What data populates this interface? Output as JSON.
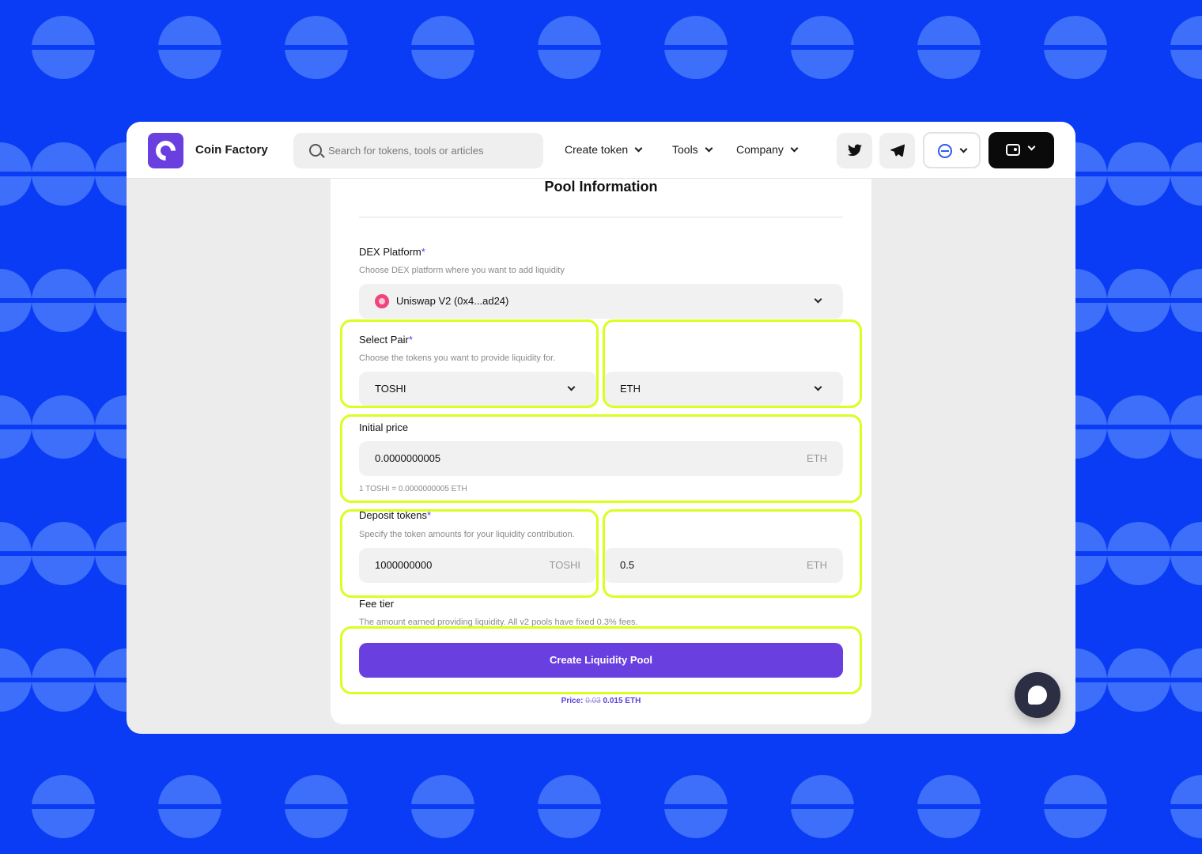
{
  "header": {
    "brand": "Coin Factory",
    "search_placeholder": "Search for tokens, tools or articles",
    "nav": [
      {
        "label": "Create token"
      },
      {
        "label": "Tools"
      },
      {
        "label": "Company"
      }
    ],
    "icons": [
      "twitter-icon",
      "telegram-icon",
      "network-icon",
      "wallet-icon"
    ]
  },
  "pool": {
    "title": "Pool Information",
    "dex_label": "DEX Platform",
    "required_mark": "*",
    "dex_hint": "Choose DEX platform where you want to add liquidity",
    "dex_value": "Uniswap V2 (0x4...ad24)",
    "pair_label": "Select Pair",
    "pair_hint": "Choose the tokens you want to provide liquidity for.",
    "pair_token_a": "TOSHI",
    "pair_token_b": "ETH",
    "price_label": "Initial price",
    "price_value": "0.0000000005",
    "price_unit": "ETH",
    "price_note": "1 TOSHI = 0.0000000005 ETH",
    "deposit_label": "Deposit tokens",
    "deposit_hint": "Specify the token amounts for your liquidity contribution.",
    "deposit_a_value": "1000000000",
    "deposit_a_unit": "TOSHI",
    "deposit_b_value": "0.5",
    "deposit_b_unit": "ETH",
    "fee_label": "Fee tier",
    "fee_hint": "The amount earned providing liquidity. All v2 pools have fixed 0.3% fees.",
    "submit_label": "Create Liquidity Pool",
    "price_caption": "Price:",
    "price_old": "0.03",
    "price_new": "0.015 ETH"
  },
  "colors": {
    "background": "#0a3cf5",
    "accent": "#6a3fe0",
    "highlight": "#d9ff1e"
  }
}
